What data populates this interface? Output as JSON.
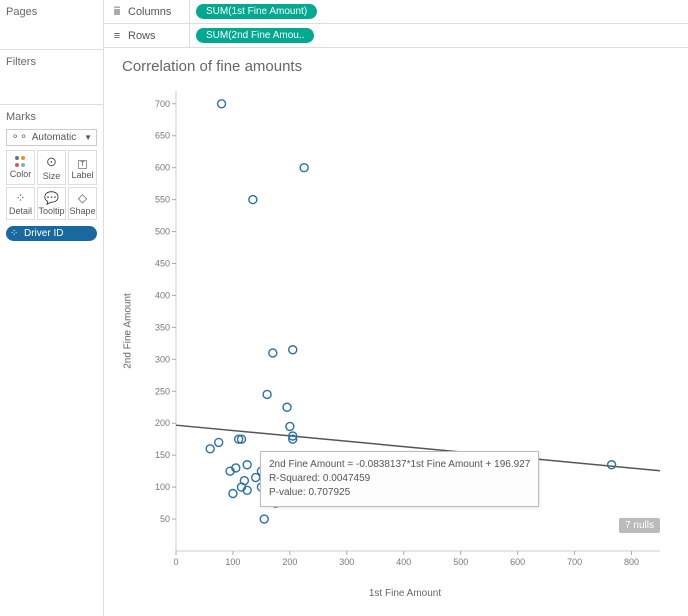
{
  "panels": {
    "pages": "Pages",
    "filters": "Filters",
    "marks": "Marks",
    "marks_dropdown": "Automatic",
    "mark_cards": [
      {
        "icon": "color",
        "label": "Color"
      },
      {
        "icon": "size",
        "label": "Size"
      },
      {
        "icon": "label",
        "label": "Label"
      },
      {
        "icon": "detail",
        "label": "Detail"
      },
      {
        "icon": "tooltip",
        "label": "Tooltip"
      },
      {
        "icon": "shape",
        "label": "Shape"
      }
    ],
    "driver_pill": "Driver ID"
  },
  "shelves": {
    "columns_label": "Columns",
    "rows_label": "Rows",
    "columns_pill": "SUM(1st Fine Amount)",
    "rows_pill": "SUM(2nd Fine Amou.."
  },
  "chart": {
    "title": "Correlation of fine amounts",
    "x_label": "1st Fine Amount",
    "y_label": "2nd Fine Amount",
    "nulls_badge": "7 nulls"
  },
  "tooltip": {
    "line1": "2nd Fine Amount = -0.0838137*1st Fine Amount + 196.927",
    "line2": "R-Squared: 0.0047459",
    "line3": "P-value: 0.707925"
  },
  "chart_data": {
    "type": "scatter",
    "xlabel": "1st Fine Amount",
    "ylabel": "2nd Fine Amount",
    "xlim": [
      0,
      850
    ],
    "ylim": [
      0,
      720
    ],
    "x_ticks": [
      0,
      100,
      200,
      300,
      400,
      500,
      600,
      700,
      800
    ],
    "y_ticks": [
      50,
      100,
      150,
      200,
      250,
      300,
      350,
      400,
      450,
      500,
      550,
      600,
      650,
      700
    ],
    "points": [
      {
        "x": 80,
        "y": 700
      },
      {
        "x": 225,
        "y": 600
      },
      {
        "x": 135,
        "y": 550
      },
      {
        "x": 170,
        "y": 310
      },
      {
        "x": 205,
        "y": 315
      },
      {
        "x": 160,
        "y": 245
      },
      {
        "x": 195,
        "y": 225
      },
      {
        "x": 60,
        "y": 160
      },
      {
        "x": 75,
        "y": 170
      },
      {
        "x": 110,
        "y": 175
      },
      {
        "x": 115,
        "y": 175
      },
      {
        "x": 200,
        "y": 195
      },
      {
        "x": 205,
        "y": 180
      },
      {
        "x": 205,
        "y": 175
      },
      {
        "x": 95,
        "y": 125
      },
      {
        "x": 105,
        "y": 130
      },
      {
        "x": 125,
        "y": 135
      },
      {
        "x": 150,
        "y": 125
      },
      {
        "x": 160,
        "y": 125
      },
      {
        "x": 100,
        "y": 90
      },
      {
        "x": 115,
        "y": 100
      },
      {
        "x": 120,
        "y": 110
      },
      {
        "x": 125,
        "y": 95
      },
      {
        "x": 140,
        "y": 115
      },
      {
        "x": 150,
        "y": 100
      },
      {
        "x": 160,
        "y": 110
      },
      {
        "x": 175,
        "y": 75
      },
      {
        "x": 195,
        "y": 90
      },
      {
        "x": 180,
        "y": 100
      },
      {
        "x": 155,
        "y": 50
      },
      {
        "x": 765,
        "y": 135
      }
    ],
    "trend": {
      "slope": -0.0838137,
      "intercept": 196.927
    }
  }
}
